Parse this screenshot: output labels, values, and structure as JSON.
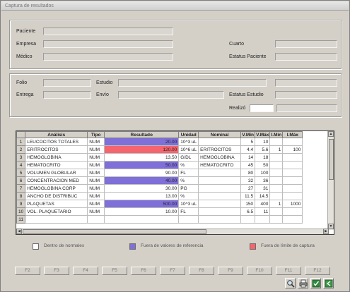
{
  "window": {
    "title": "Captura de resultados"
  },
  "patient": {
    "paciente_label": "Paciente",
    "paciente_value": "",
    "empresa_label": "Empresa",
    "empresa_value": "",
    "medico_label": "Médico",
    "medico_value": "",
    "cuarto_label": "Cuarto",
    "cuarto_value": "",
    "estatus_paciente_label": "Estatus Paciente",
    "estatus_paciente_value": ""
  },
  "study": {
    "folio_label": "Folio",
    "folio_value": "",
    "estudio_label": "Estudio",
    "estudio_value": "",
    "estudio_extra": "",
    "entrega_label": "Entrega",
    "entrega_value": "",
    "envio_label": "Envío",
    "envio_value": "",
    "estatus_estudio_label": "Estatus Estudio",
    "estatus_estudio_value": "",
    "realizo_label": "Realizó",
    "realizo_value": "",
    "realizo_name": ""
  },
  "grid": {
    "columns": [
      "",
      "Análisis",
      "Tipo",
      "Resultado",
      "Unidad",
      "Nominal",
      "V.Mín",
      "V.Máx",
      "I.Mín",
      "I.Máx"
    ],
    "rows": [
      {
        "n": "1",
        "analisis": "LEUCOCITOS TOTALES",
        "tipo": "NUM",
        "resultado": "20.00",
        "flag": "ref",
        "unidad": "10^3 uL",
        "nominal": "",
        "vmin": "5",
        "vmax": "10",
        "imin": "",
        "imax": ""
      },
      {
        "n": "2",
        "analisis": "ERITROCITOS",
        "tipo": "NUM",
        "resultado": "120.00",
        "flag": "crit",
        "unidad": "10^6 uL",
        "nominal": "ERITROCITOS",
        "vmin": "4.4",
        "vmax": "5.6",
        "imin": "1",
        "imax": "100"
      },
      {
        "n": "3",
        "analisis": "HEMOGLOBINA",
        "tipo": "NUM",
        "resultado": "13.50",
        "flag": "normal",
        "unidad": "G/DL",
        "nominal": "HEMOGLOBINA",
        "vmin": "14",
        "vmax": "18",
        "imin": "",
        "imax": ""
      },
      {
        "n": "4",
        "analisis": "HEMATOCRITO",
        "tipo": "NUM",
        "resultado": "50.00",
        "flag": "ref",
        "unidad": "%",
        "nominal": "HEMATOCRITO",
        "vmin": "45",
        "vmax": "50",
        "imin": "",
        "imax": ""
      },
      {
        "n": "5",
        "analisis": "VOLUMEN GLOBULAR",
        "tipo": "NUM",
        "resultado": "90.00",
        "flag": "normal",
        "unidad": "FL",
        "nominal": "",
        "vmin": "80",
        "vmax": "100",
        "imin": "",
        "imax": ""
      },
      {
        "n": "6",
        "analisis": "CONCENTRACION MED",
        "tipo": "NUM",
        "resultado": "40.00",
        "flag": "ref",
        "unidad": "%",
        "nominal": "",
        "vmin": "32",
        "vmax": "36",
        "imin": "",
        "imax": ""
      },
      {
        "n": "7",
        "analisis": "HEMOGLOBINA CORP",
        "tipo": "NUM",
        "resultado": "30.00",
        "flag": "normal",
        "unidad": "PG",
        "nominal": "",
        "vmin": "27",
        "vmax": "31",
        "imin": "",
        "imax": ""
      },
      {
        "n": "8",
        "analisis": "ANCHO DE DISTRIBUC",
        "tipo": "NUM",
        "resultado": "13.00",
        "flag": "normal",
        "unidad": "%",
        "nominal": "",
        "vmin": "11.5",
        "vmax": "14.5",
        "imin": "",
        "imax": ""
      },
      {
        "n": "9",
        "analisis": "PLAQUETAS",
        "tipo": "NUM",
        "resultado": "500.00",
        "flag": "ref",
        "unidad": "10^3 uL",
        "nominal": "",
        "vmin": "150",
        "vmax": "400",
        "imin": "1",
        "imax": "1000"
      },
      {
        "n": "10",
        "analisis": "VOL. PLAQUETARIO",
        "tipo": "NUM",
        "resultado": "10.00",
        "flag": "normal",
        "unidad": "FL",
        "nominal": "",
        "vmin": "6.5",
        "vmax": "11",
        "imin": "",
        "imax": ""
      },
      {
        "n": "11",
        "analisis": "",
        "tipo": "",
        "resultado": "",
        "flag": "normal",
        "unidad": "",
        "nominal": "",
        "vmin": "",
        "vmax": "",
        "imin": "",
        "imax": ""
      }
    ]
  },
  "legend": {
    "normal": "Dentro de normales",
    "ref": "Fuera de valores de referencia",
    "crit": "Fuera de límite de captura",
    "colors": {
      "normal": "#ffffff",
      "ref": "#7f6fd8",
      "crit": "#f4656e"
    }
  },
  "fkeys": [
    "F2",
    "F3",
    "F4",
    "F5",
    "F6",
    "F7",
    "F8",
    "F9",
    "F10",
    "F11",
    "F12"
  ],
  "toolbar": {
    "search": "search-icon",
    "print": "print-icon",
    "save": "save-icon",
    "exit": "exit-icon"
  }
}
